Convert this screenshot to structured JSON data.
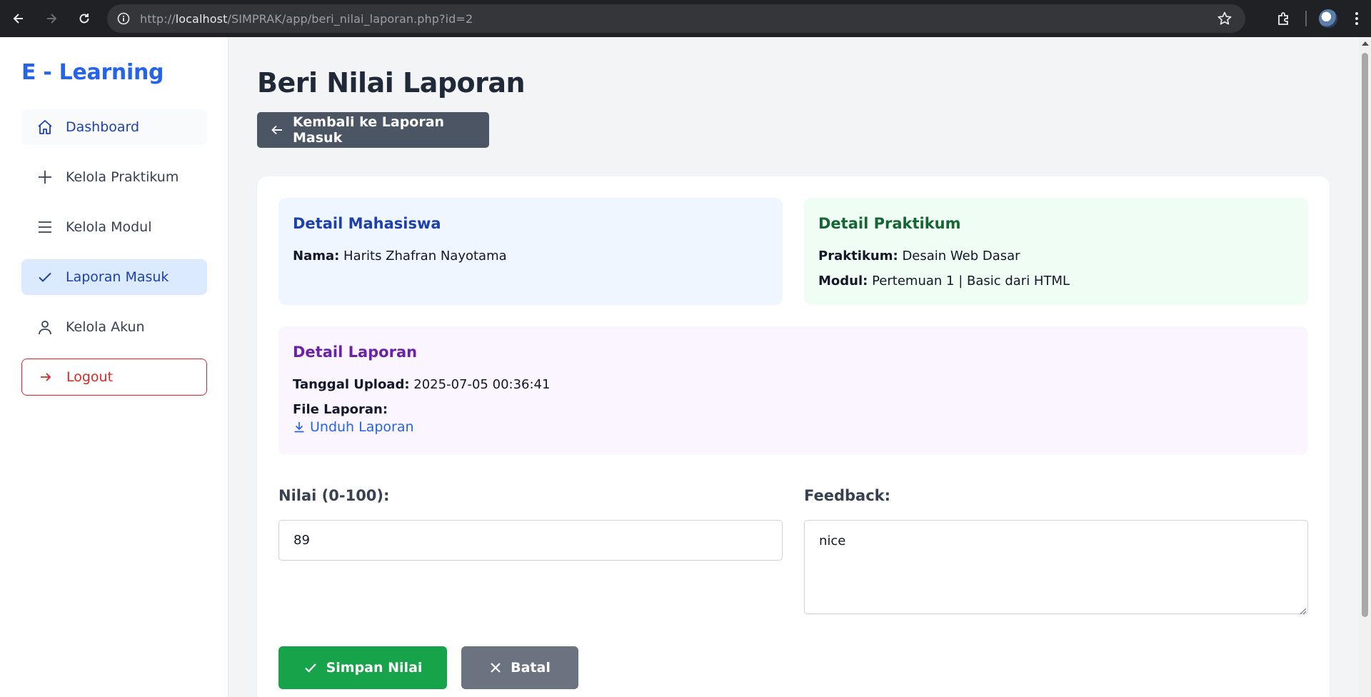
{
  "browser": {
    "url_prefix": "http://",
    "url_host": "localhost",
    "url_path": "/SIMPRAK/app/beri_nilai_laporan.php?id=2"
  },
  "sidebar": {
    "brand": "E - Learning",
    "items": [
      {
        "label": "Dashboard",
        "icon": "home-icon"
      },
      {
        "label": "Kelola Praktikum",
        "icon": "plus-icon"
      },
      {
        "label": "Kelola Modul",
        "icon": "menu-icon"
      },
      {
        "label": "Laporan Masuk",
        "icon": "check-icon"
      },
      {
        "label": "Kelola Akun",
        "icon": "user-icon"
      }
    ],
    "logout": "Logout"
  },
  "page": {
    "title": "Beri Nilai Laporan",
    "back_button": "Kembali ke Laporan Masuk"
  },
  "mahasiswa": {
    "heading": "Detail Mahasiswa",
    "nama_label": "Nama:",
    "nama": "Harits Zhafran Nayotama"
  },
  "praktikum": {
    "heading": "Detail Praktikum",
    "praktikum_label": "Praktikum:",
    "praktikum": "Desain Web Dasar",
    "modul_label": "Modul:",
    "modul": "Pertemuan 1 | Basic dari HTML"
  },
  "laporan": {
    "heading": "Detail Laporan",
    "tanggal_label": "Tanggal Upload:",
    "tanggal": "2025-07-05 00:36:41",
    "file_label": "File Laporan:",
    "download": "Unduh Laporan"
  },
  "form": {
    "nilai_label": "Nilai (0-100):",
    "nilai_value": "89",
    "feedback_label": "Feedback:",
    "feedback_value": "nice",
    "save_button": "Simpan Nilai",
    "cancel_button": "Batal"
  },
  "colors": {
    "accent": "#2563eb",
    "success": "#16a34a",
    "danger": "#dc2626",
    "neutral_button": "#4b5563"
  }
}
